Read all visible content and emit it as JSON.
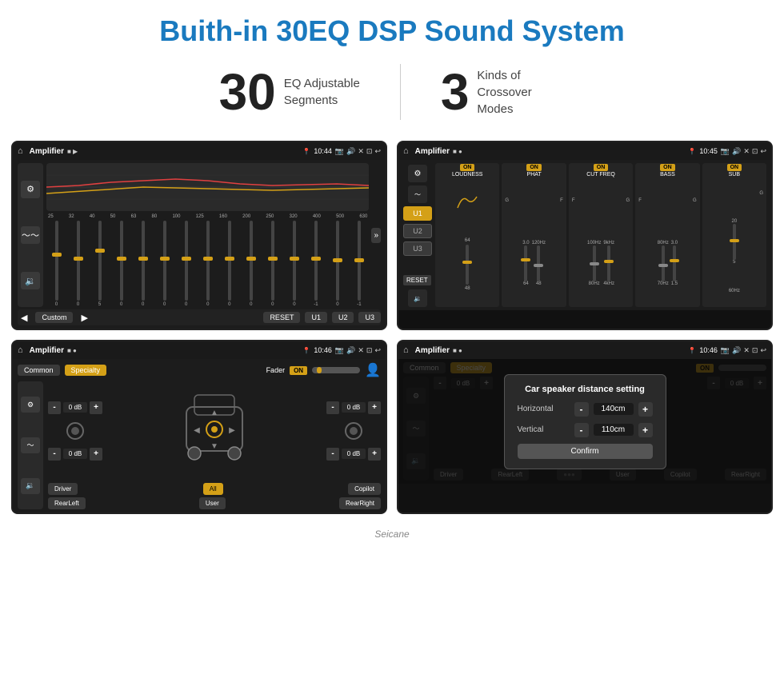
{
  "page": {
    "title": "Buith-in 30EQ DSP Sound System",
    "stat1_number": "30",
    "stat1_label": "EQ Adjustable\nSegments",
    "stat2_number": "3",
    "stat2_label": "Kinds of\nCrossover Modes"
  },
  "screen1": {
    "title": "Amplifier",
    "time": "10:44",
    "freq_labels": [
      "25",
      "32",
      "40",
      "50",
      "63",
      "80",
      "100",
      "125",
      "160",
      "200",
      "250",
      "320",
      "400",
      "500",
      "630"
    ],
    "custom_label": "Custom",
    "reset_label": "RESET",
    "u1_label": "U1",
    "u2_label": "U2",
    "u3_label": "U3"
  },
  "screen2": {
    "title": "Amplifier",
    "time": "10:45",
    "u1": "U1",
    "u2": "U2",
    "u3": "U3",
    "reset_label": "RESET",
    "channels": [
      {
        "on": "ON",
        "label": "LOUDNESS"
      },
      {
        "on": "ON",
        "label": "PHAT"
      },
      {
        "on": "ON",
        "label": "CUT FREQ"
      },
      {
        "on": "ON",
        "label": "BASS"
      },
      {
        "on": "ON",
        "label": "SUB"
      }
    ]
  },
  "screen3": {
    "title": "Amplifier",
    "time": "10:46",
    "common_tab": "Common",
    "specialty_tab": "Specialty",
    "fader_label": "Fader",
    "on_label": "ON",
    "db_values": [
      "0 dB",
      "0 dB",
      "0 dB",
      "0 dB"
    ],
    "driver_label": "Driver",
    "all_label": "All",
    "rear_left": "RearLeft",
    "rear_right": "RearRight",
    "copilot_label": "Copilot",
    "user_label": "User"
  },
  "screen4": {
    "title": "Amplifier",
    "time": "10:46",
    "common_tab": "Common",
    "specialty_tab": "Specialty",
    "on_label": "ON",
    "dialog_title": "Car speaker distance setting",
    "horizontal_label": "Horizontal",
    "horizontal_value": "140cm",
    "vertical_label": "Vertical",
    "vertical_value": "110cm",
    "confirm_label": "Confirm",
    "db_values": [
      "0 dB",
      "0 dB"
    ],
    "driver_label": "Driver",
    "rear_left": "RearLeft",
    "copilot_label": "Copilot",
    "rear_right": "RearRight",
    "user_label": "User"
  },
  "watermark": "Seicane"
}
